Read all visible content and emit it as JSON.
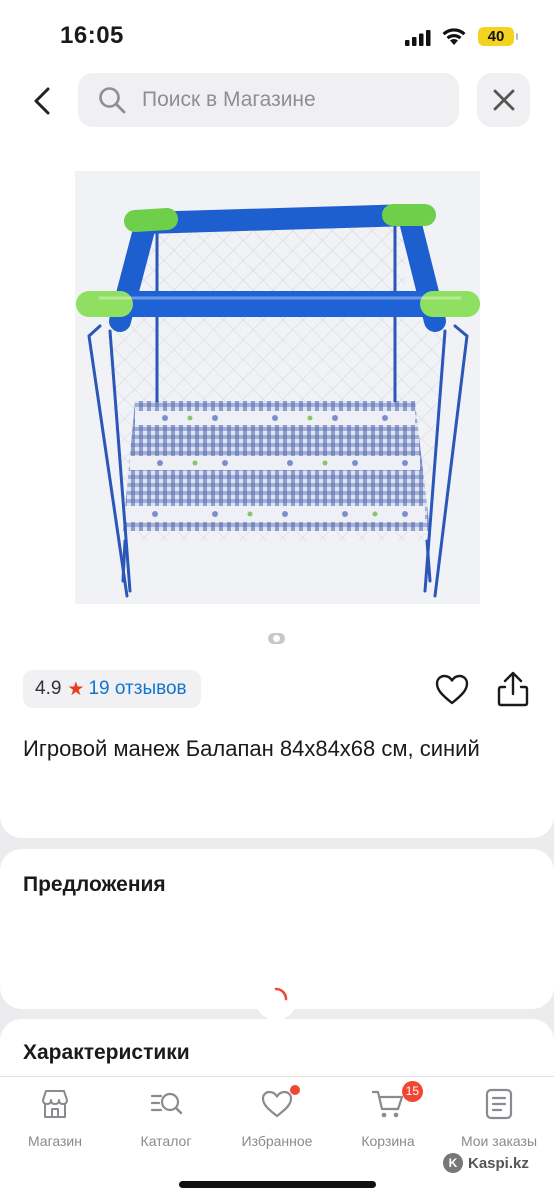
{
  "status_bar": {
    "time": "16:05",
    "battery": "40"
  },
  "header": {
    "search_placeholder": "Поиск в Магазине"
  },
  "product": {
    "rating": "4.9",
    "reviews": "19 отзывов",
    "title": "Игровой манеж Балапан 84x84x68 см, синий",
    "images_total": 1,
    "image_active": 1
  },
  "sections": {
    "offers_title": "Предложения",
    "characteristics_title": "Характеристики"
  },
  "tabs": [
    {
      "label": "Магазин",
      "icon": "store-icon"
    },
    {
      "label": "Каталог",
      "icon": "catalog-search-icon"
    },
    {
      "label": "Избранное",
      "icon": "heart-icon",
      "dot": true
    },
    {
      "label": "Корзина",
      "icon": "cart-icon",
      "badge": "15"
    },
    {
      "label": "Мои заказы",
      "icon": "orders-icon"
    }
  ],
  "watermark": "Kaspi.kz",
  "colors": {
    "accent_red": "#f04632",
    "link_blue": "#1276cc",
    "star": "#e83c1c"
  }
}
